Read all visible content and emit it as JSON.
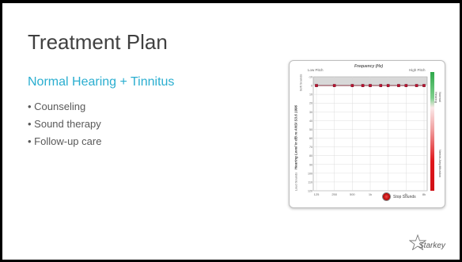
{
  "slide": {
    "title": "Treatment Plan",
    "subtitle": "Normal Hearing + Tinnitus",
    "bullets": [
      "Counseling",
      "Sound therapy",
      "Follow-up care"
    ],
    "logo_text": "Starkey"
  },
  "audiogram": {
    "title": "Frequency (Hz)",
    "low_pitch": "Low Pitch",
    "high_pitch": "High Pitch",
    "y_label": "Hearing Level in dB re ANSI S3.6 1996",
    "soft_sounds": "Soft Sounds",
    "loud_sounds": "Loud Sounds",
    "normal_hearing": "Normal Hearing",
    "needs_amplification": "Needs Amplification",
    "stop_sounds": "Stop Sounds",
    "colors": {
      "line": "#7a1a2a",
      "point": "#c01030",
      "normal_band": "#2ea84a",
      "loss_band": "#e0161b"
    }
  },
  "chart_data": {
    "type": "line",
    "title": "Frequency (Hz)",
    "xlabel": "Frequency (Hz)",
    "ylabel": "Hearing Level in dB re ANSI S3.6 1996",
    "x_ticks": [
      "125",
      "250",
      "500",
      "1k",
      "2k",
      "4k",
      "8k"
    ],
    "y_ticks": [
      "-10",
      "0",
      "10",
      "20",
      "30",
      "40",
      "50",
      "60",
      "70",
      "80",
      "90",
      "100",
      "110",
      "120"
    ],
    "ylim": [
      -10,
      120
    ],
    "y_inverted": true,
    "series": [
      {
        "x": [
          "125",
          "250",
          "500",
          "750",
          "1k",
          "1.5k",
          "2k",
          "3k",
          "4k",
          "6k",
          "8k"
        ],
        "values": [
          0,
          0,
          0,
          0,
          0,
          0,
          0,
          0,
          0,
          0,
          0
        ]
      }
    ],
    "grid": true
  }
}
